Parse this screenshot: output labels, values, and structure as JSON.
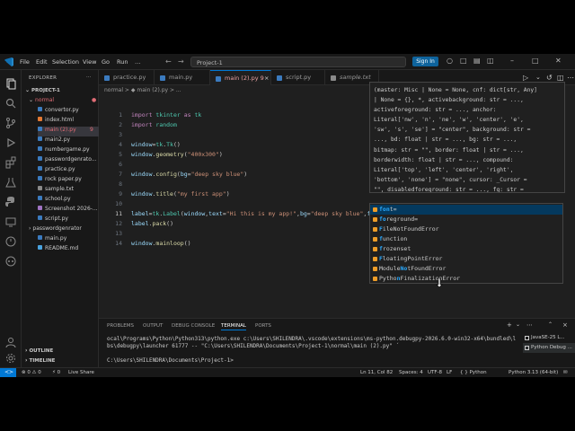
{
  "titlebar": {
    "menus": [
      "File",
      "Edit",
      "Selection",
      "View",
      "Go",
      "Run"
    ],
    "more_menu": "…",
    "search_text": "Project-1",
    "sign_in": "Sign In"
  },
  "sidebar": {
    "header": "EXPLORER",
    "project": "PROJECT-1",
    "items": [
      {
        "label": "normal",
        "type": "folder-open",
        "badge": "●"
      },
      {
        "label": "convertor.py",
        "type": "py"
      },
      {
        "label": "index.html",
        "type": "html"
      },
      {
        "label": "main (2).py",
        "type": "py",
        "badge": "9"
      },
      {
        "label": "main2.py",
        "type": "py"
      },
      {
        "label": "numbergame.py",
        "type": "py"
      },
      {
        "label": "passwordgenrato...",
        "type": "py"
      },
      {
        "label": "practice.py",
        "type": "py"
      },
      {
        "label": "rock paper.py",
        "type": "py"
      },
      {
        "label": "sample.txt",
        "type": "txt"
      },
      {
        "label": "school.py",
        "type": "py"
      },
      {
        "label": "Screenshot 2026-...",
        "type": "png"
      },
      {
        "label": "script.py",
        "type": "py"
      },
      {
        "label": "passwordgenrator",
        "type": "folder"
      },
      {
        "label": "main.py",
        "type": "py"
      },
      {
        "label": "README.md",
        "type": "md"
      }
    ],
    "outline": "OUTLINE",
    "timeline": "TIMELINE"
  },
  "tabs": [
    {
      "label": "practice.py",
      "active": false
    },
    {
      "label": "main.py",
      "active": false
    },
    {
      "label": "main (2).py  9",
      "active": true
    },
    {
      "label": "script.py",
      "active": false
    },
    {
      "label": "sample.txt",
      "active": false
    }
  ],
  "breadcrumb": "normal > ◆ main (2).py > ...",
  "editor": {
    "lines": [
      {
        "n": "1",
        "html": "<span class='kw'>import</span> <span class='cls'>tkinter</span> <span class='kw'>as</span> <span class='cls'>tk</span>"
      },
      {
        "n": "2",
        "html": "<span class='kw'>import</span> <span class='cls'>random</span>"
      },
      {
        "n": "3",
        "html": ""
      },
      {
        "n": "4",
        "html": "<span class='var'>window</span>=<span class='cls'>tk</span>.<span class='cls'>Tk</span>()"
      },
      {
        "n": "5",
        "html": "<span class='var'>window</span>.<span class='fn'>geometry</span>(<span class='str'>\"400x300\"</span>)"
      },
      {
        "n": "6",
        "html": ""
      },
      {
        "n": "7",
        "html": "<span class='var'>window</span>.<span class='fn'>config</span>(<span class='var'>bg</span>=<span class='str'>\"deep sky blue\"</span>)"
      },
      {
        "n": "8",
        "html": ""
      },
      {
        "n": "9",
        "html": "<span class='var'>window</span>.<span class='fn'>title</span>(<span class='str'>\"my first app\"</span>)"
      },
      {
        "n": "10",
        "html": ""
      },
      {
        "n": "11",
        "html": "<span class='var'>label</span>=<span class='cls'>tk</span>.<span class='cls'>Label</span>(<span class='var'>window</span>,<span class='var'>text</span>=<span class='str'>\"Hi this is my app!\"</span>,<span class='var'>bg</span>=<span class='str'>\"deep sky blue\"</span>,<span class='var'>fg</span>=<span class='str'>\"black\"</span>,<span class='var'>fon</span>)"
      },
      {
        "n": "12",
        "html": "<span class='var'>label</span>.<span class='fn'>pack</span>()"
      },
      {
        "n": "13",
        "html": ""
      },
      {
        "n": "14",
        "html": "<span class='var'>window</span>.<span class='fn'>mainloop</span>()"
      }
    ]
  },
  "signature": "(master: Misc | None = None, cnf: dict[str, Any]\n| None = {}, *, activebackground: str = ...,\nactiveforeground: str = ..., anchor:\nLiteral['nw', 'n', 'ne', 'w', 'center', 'e',\n'sw', 's', 'se'] = \"center\", background: str =\n..., bd: float | str = ..., bg: str = ...,\nbitmap: str = \"\", border: float | str = ...,\nborderwidth: float | str = ..., compound:\nLiteral['top', 'left', 'center', 'right',\n'bottom', 'none'] = \"none\", cursor: _Cursor =\n\"\", disabledforeground: str = ..., fg: str =",
  "suggestions": [
    {
      "pre": "",
      "match": "fon",
      "rest": "t=",
      "selected": true
    },
    {
      "pre": "",
      "match": "fo",
      "rest": "reground=",
      "selected": false
    },
    {
      "pre": "",
      "match": "F",
      "rest": "ileNotFoundError",
      "selected": false
    },
    {
      "pre": "",
      "match": "f",
      "rest": "unction",
      "selected": false
    },
    {
      "pre": "",
      "match": "f",
      "rest": "rozenset",
      "selected": false
    },
    {
      "pre": "",
      "match": "F",
      "rest": "loatingPointError",
      "selected": false
    },
    {
      "pre": "Module",
      "match": "No",
      "rest": "tFoundError",
      "selected": false
    },
    {
      "pre": "Pytho",
      "match": "n",
      "rest": "FinalizationError",
      "selected": false
    }
  ],
  "panel": {
    "tabs": [
      "PROBLEMS",
      "OUTPUT",
      "DEBUG CONSOLE",
      "TERMINAL",
      "PORTS"
    ],
    "active_tab": "TERMINAL",
    "terminal_text": "ocal\\Programs\\Python\\Python313\\python.exe c:\\Users\\SHILENDRA\\.vscode\\extensions\\ms-python.debugpy-2026.6.0-win32-x64\\bundled\\li\nbs\\debugpy\\launcher 61777 -- \"C:\\Users\\SHILENDRA\\Documents\\Project-1\\normal\\main (2).py\" ´\n\nC:\\Users\\SHILENDRA\\Documents\\Project-1>",
    "terminals": [
      {
        "label": "JavaSE-25 L...",
        "selected": false
      },
      {
        "label": "Python Debug ...",
        "selected": true
      }
    ]
  },
  "statusbar": {
    "problems": "⊗ 0  ⚠ 0",
    "ports": "⚡ 0",
    "live_share": "Live Share",
    "position": "Ln 11, Col 82",
    "spaces": "Spaces: 4",
    "encoding": "UTF-8",
    "eol": "LF",
    "language": "{ } Python",
    "interpreter": "Python 3.13 (64-bit)"
  },
  "colors": {
    "accent": "#0078d4",
    "selection": "#04395e",
    "keyword": "#c586c0",
    "string": "#ce9178",
    "function": "#dcdcaa"
  }
}
